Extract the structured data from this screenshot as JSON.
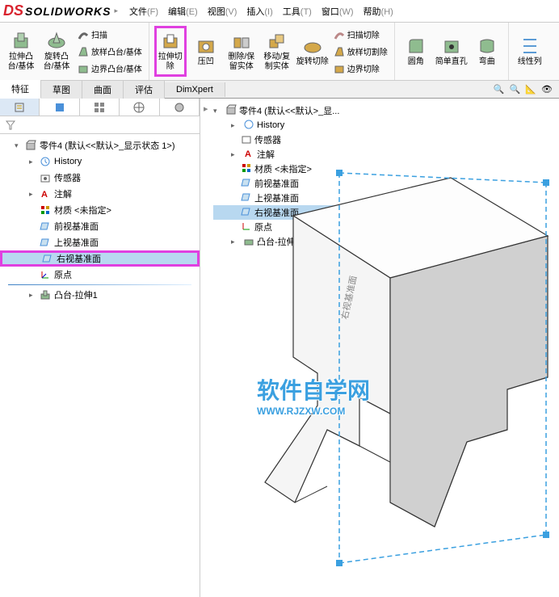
{
  "app": {
    "name": "SOLIDWORKS"
  },
  "menu": [
    {
      "label": "文件",
      "acc": "(F)"
    },
    {
      "label": "编辑",
      "acc": "(E)"
    },
    {
      "label": "视图",
      "acc": "(V)"
    },
    {
      "label": "插入",
      "acc": "(I)"
    },
    {
      "label": "工具",
      "acc": "(T)"
    },
    {
      "label": "窗口",
      "acc": "(W)"
    },
    {
      "label": "帮助",
      "acc": "(H)"
    }
  ],
  "ribbon": {
    "extrude_boss": "拉伸凸台/基体",
    "revolve_boss": "旋转凸台/基体",
    "swept": "扫描",
    "loft": "放样凸台/基体",
    "boundary": "边界凸台/基体",
    "cut_extrude": "拉伸切除",
    "hole_wizard": "压凹",
    "delete_keep": "删除/保留实体",
    "move_copy": "移动/复制实体",
    "revolve_cut": "旋转切除",
    "swept_cut": "扫描切除",
    "loft_cut": "放样切割除",
    "boundary_cut": "边界切除",
    "fillet": "圆角",
    "simple_hole": "简单直孔",
    "wrap": "弯曲",
    "linear_pattern": "线性列"
  },
  "tabs": [
    "特征",
    "草图",
    "曲面",
    "评估",
    "DimXpert"
  ],
  "fm_title": "零件4  (默认<<默认>_显示状态 1>)",
  "tree": {
    "history": "History",
    "sensors": "传感器",
    "annotations": "注解",
    "material": "材质 <未指定>",
    "front_plane": "前视基准面",
    "top_plane": "上视基准面",
    "right_plane": "右视基准面",
    "origin": "原点",
    "extrude1": "凸台-拉伸1"
  },
  "fly_title": "零件4 (默认<<默认>_显...",
  "plane_label": "右视基准面",
  "watermark": {
    "text": "软件自学网",
    "url": "WWW.RJZXW.COM"
  }
}
